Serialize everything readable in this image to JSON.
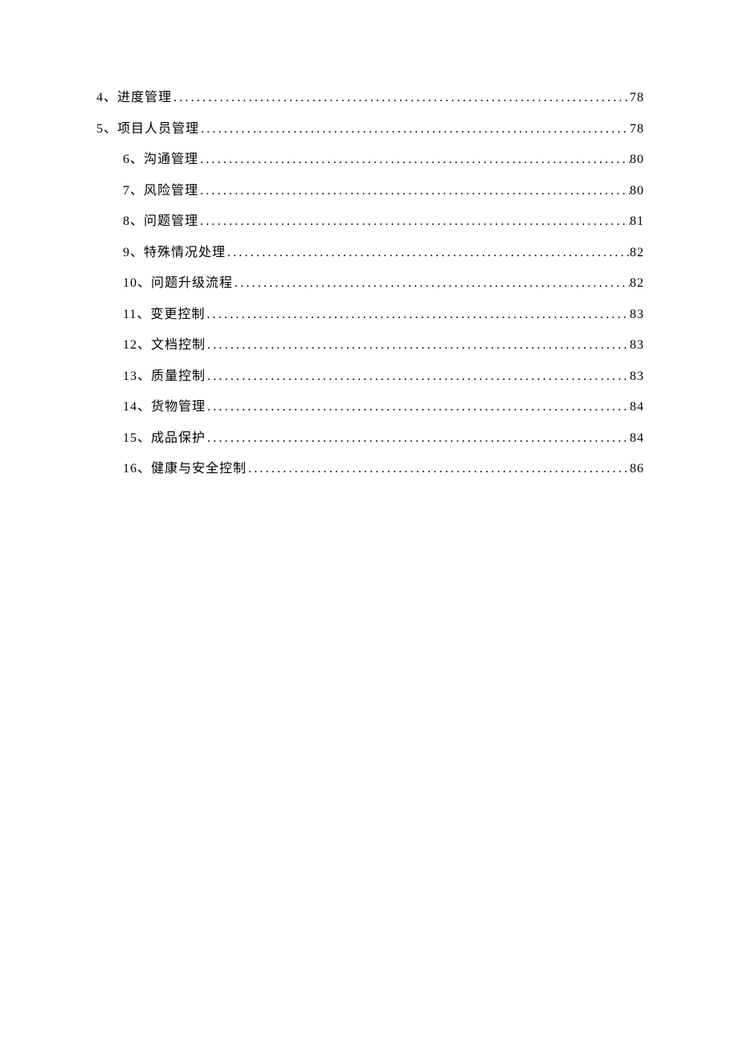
{
  "toc": {
    "entries": [
      {
        "title": "4、进度管理",
        "page": "78",
        "level": 1
      },
      {
        "title": "5、项目人员管理",
        "page": "78",
        "level": 1
      },
      {
        "title": "6、沟通管理",
        "page": "80",
        "level": 2
      },
      {
        "title": "7、风险管理",
        "page": "80",
        "level": 2
      },
      {
        "title": "8、问题管理",
        "page": "81",
        "level": 2
      },
      {
        "title": "9、特殊情况处理",
        "page": "82",
        "level": 2
      },
      {
        "title": "10、问题升级流程",
        "page": "82",
        "level": 2
      },
      {
        "title": "11、变更控制",
        "page": "83",
        "level": 2
      },
      {
        "title": "12、文档控制",
        "page": "83",
        "level": 2
      },
      {
        "title": "13、质量控制",
        "page": "83",
        "level": 2
      },
      {
        "title": "14、货物管理",
        "page": "84",
        "level": 2
      },
      {
        "title": "15、成品保护",
        "page": "84",
        "level": 2
      },
      {
        "title": "16、健康与安全控制",
        "page": "86",
        "level": 2
      }
    ]
  }
}
